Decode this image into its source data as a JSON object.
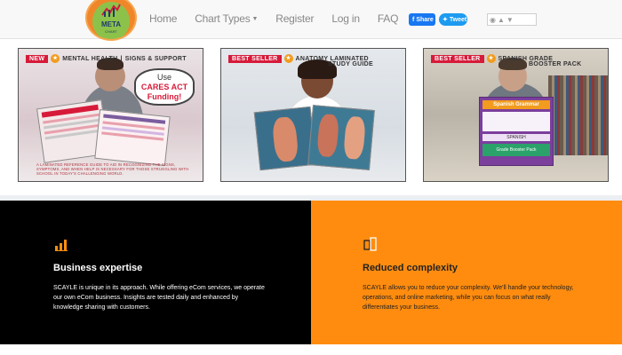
{
  "nav": {
    "logo_text": "META",
    "logo_sub": "CHART",
    "links": [
      "Home",
      "Chart Types",
      "Register",
      "Log in",
      "FAQ"
    ],
    "share_label": "Share",
    "tweet_label": "Tweet"
  },
  "cards": [
    {
      "tag": "NEW",
      "title": "MENTAL HEALTH",
      "subtitle": "SIGNS & SUPPORT",
      "bubble_line1": "Use",
      "bubble_line2": "CARES ACT",
      "bubble_line3": "Funding!",
      "footer": "A LAMINATED REFERENCE GUIDE TO AID IN RECOGNIZING THE SIGNS, SYMPTOMS, AND WHEN HELP IS NECESSARY FOR THOSE STRUGGLING WITH SCHOOL IN TODAY'S CHALLENGING WORLD."
    },
    {
      "tag": "BEST SELLER",
      "title": "ANATOMY LAMINATED",
      "subtitle": "STUDY GUIDE"
    },
    {
      "tag": "BEST SELLER",
      "title": "SPANISH GRADE",
      "subtitle": "BOOSTER PACK",
      "guide_labels": [
        "Spanish Grammar",
        "SPANISH",
        "Grade Booster Pack"
      ]
    }
  ],
  "features": [
    {
      "title": "Business expertise",
      "body": "SCAYLE is unique in its approach. While offering eCom services, we operate our own eCom business. Insights are tested daily and enhanced by knowledge sharing with customers.",
      "icon": "bar-chart-icon"
    },
    {
      "title": "Reduced complexity",
      "body": "SCAYLE allows you to reduce your complexity. We'll handle your technology, operations, and online marketing, while you can focus on what really differentiates your business.",
      "icon": "layers-icon"
    }
  ],
  "colors": {
    "accent_orange": "#ff8c0f",
    "dark_section": "#000000",
    "tag_red": "#d71a3a",
    "facebook_blue": "#1877f2",
    "twitter_blue": "#1d9bf0"
  }
}
